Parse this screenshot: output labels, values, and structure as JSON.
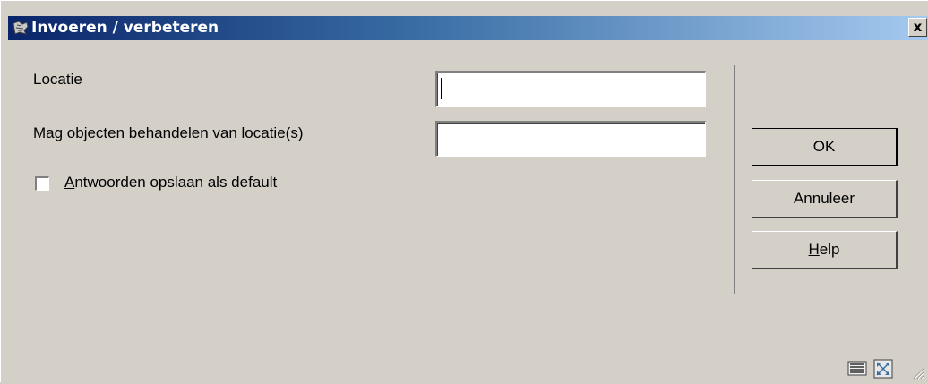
{
  "window": {
    "title": "Invoeren / verbeteren",
    "close_label": "x",
    "colors": {
      "background": "#d4d0c8",
      "titlebar_start": "#0a246a",
      "titlebar_end": "#a6caf0"
    }
  },
  "form": {
    "locatie_label": "Locatie",
    "locatie_value": "",
    "mag_label": "Mag objecten behandelen van locatie(s)",
    "mag_value": "",
    "checkbox": {
      "mnemonic": "A",
      "rest": "ntwoorden opslaan als default",
      "checked": false
    }
  },
  "buttons": {
    "ok": "OK",
    "annuleer": "Annuleer",
    "help_mnemonic": "H",
    "help_rest": "elp"
  },
  "icons": {
    "title": "app-scroll-icon",
    "status_left": "keyboard-icon",
    "status_right": "maximize-icon",
    "grip": "resize-grip-icon"
  }
}
